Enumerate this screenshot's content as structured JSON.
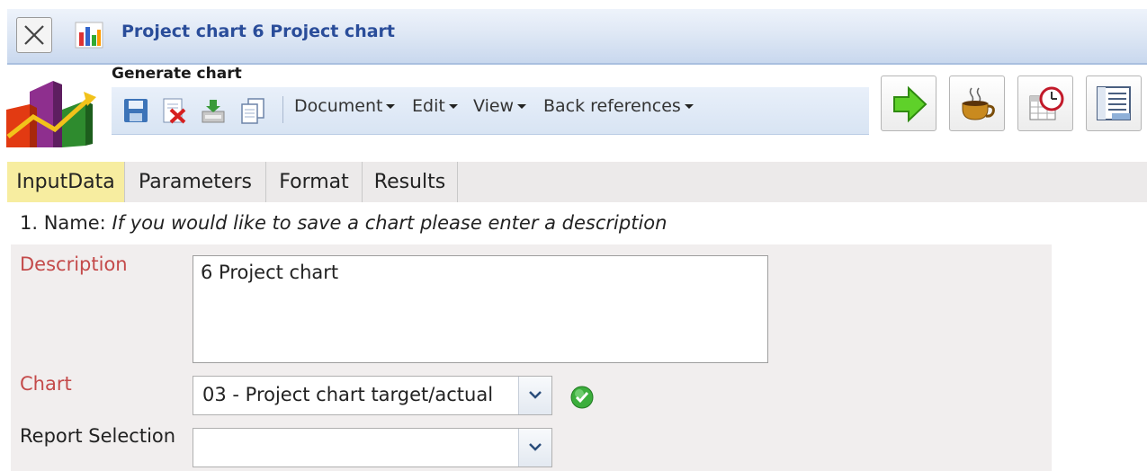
{
  "window": {
    "title": "Project chart 6 Project chart"
  },
  "toolbar": {
    "section_label": "Generate chart",
    "menus": [
      "Document",
      "Edit",
      "View",
      "Back references"
    ],
    "icons": [
      "save-icon",
      "delete-icon",
      "export-icon",
      "copy-icon"
    ],
    "action_buttons": [
      "run-arrow-icon",
      "coffee-cup-icon",
      "schedule-calendar-icon",
      "sheet-settings-icon"
    ]
  },
  "tabs": [
    {
      "label": "InputData",
      "active": true
    },
    {
      "label": "Parameters",
      "active": false
    },
    {
      "label": "Format",
      "active": false
    },
    {
      "label": "Results",
      "active": false
    }
  ],
  "form": {
    "section_number": "1. Name:",
    "section_hint": "If you would like to save a chart please enter a description",
    "description_label": "Description",
    "description_value": "6 Project chart",
    "chart_label": "Chart",
    "chart_value": "03 - Project chart target/actual",
    "report_selection_label": "Report Selection",
    "report_selection_value": ""
  },
  "colors": {
    "title_text": "#2a4d9a",
    "required_label": "#c44a4a",
    "active_tab": "#f7eda0",
    "form_background": "#f1eeee"
  }
}
